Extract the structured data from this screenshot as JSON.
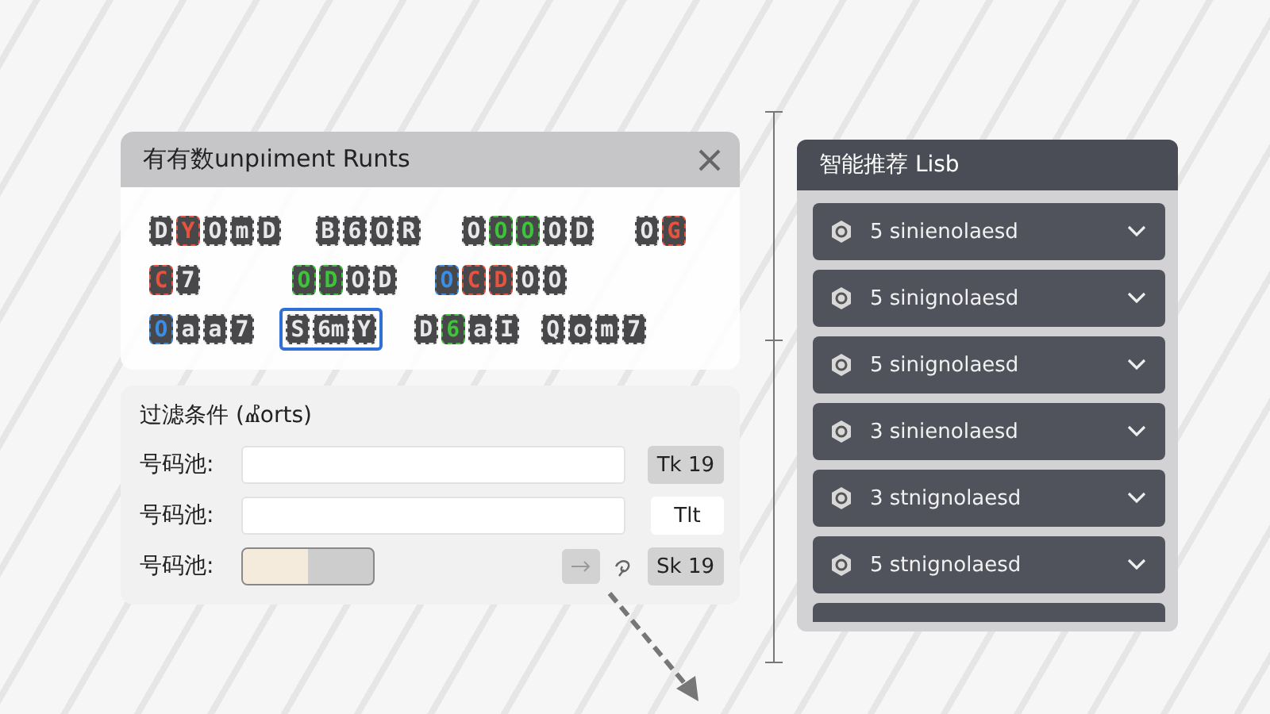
{
  "dialog": {
    "title": "有有数unpıiment Runts",
    "tile_rows": [
      [
        {
          "selected": false,
          "tiles": [
            {
              "char": "D",
              "color": "#e8e8e8"
            },
            {
              "char": "Y",
              "color": "#e8533f"
            },
            {
              "char": "O",
              "color": "#e8e8e8"
            },
            {
              "char": "m",
              "color": "#e8e8e8"
            },
            {
              "char": "D",
              "color": "#e8e8e8"
            }
          ]
        },
        {
          "selected": false,
          "tiles": [
            {
              "char": "B",
              "color": "#e8e8e8"
            },
            {
              "char": "6",
              "color": "#e8e8e8"
            },
            {
              "char": "O",
              "color": "#e8e8e8"
            },
            {
              "char": "R",
              "color": "#e8e8e8"
            }
          ]
        },
        {
          "selected": false,
          "tiles": [
            {
              "char": "O",
              "color": "#e8e8e8"
            },
            {
              "char": "O",
              "color": "#3ec43a"
            },
            {
              "char": "O",
              "color": "#3ec43a"
            },
            {
              "char": "O",
              "color": "#e8e8e8"
            },
            {
              "char": "D",
              "color": "#e8e8e8"
            }
          ]
        },
        {
          "selected": false,
          "tiles": [
            {
              "char": "O",
              "color": "#e8e8e8"
            },
            {
              "char": "G",
              "color": "#e8533f"
            }
          ]
        }
      ],
      [
        {
          "selected": false,
          "tiles": [
            {
              "char": "C",
              "color": "#e8533f"
            },
            {
              "char": "7",
              "color": "#e8e8e8"
            }
          ]
        },
        {
          "selected": false,
          "tiles": [
            {
              "char": "O",
              "color": "#3ec43a"
            },
            {
              "char": "D",
              "color": "#3ec43a"
            },
            {
              "char": "O",
              "color": "#e8e8e8"
            },
            {
              "char": "D",
              "color": "#e8e8e8"
            }
          ]
        },
        {
          "selected": false,
          "tiles": [
            {
              "char": "O",
              "color": "#3a8ee8"
            },
            {
              "char": "C",
              "color": "#e8533f"
            },
            {
              "char": "D",
              "color": "#e8533f"
            },
            {
              "char": "O",
              "color": "#e8e8e8"
            },
            {
              "char": "O",
              "color": "#e8e8e8"
            }
          ]
        }
      ],
      [
        {
          "selected": false,
          "tiles": [
            {
              "char": "O",
              "color": "#3a8ee8"
            },
            {
              "char": "a",
              "color": "#e8e8e8"
            },
            {
              "char": "a",
              "color": "#e8e8e8"
            },
            {
              "char": "7",
              "color": "#e8e8e8"
            }
          ]
        },
        {
          "selected": true,
          "tiles": [
            {
              "char": "S",
              "color": "#e8e8e8"
            },
            {
              "char": "6m",
              "color": "#e8e8e8"
            },
            {
              "char": "Y",
              "color": "#e8e8e8"
            }
          ]
        },
        {
          "selected": false,
          "tiles": [
            {
              "char": "D",
              "color": "#e8e8e8"
            },
            {
              "char": "6",
              "color": "#3ec43a"
            },
            {
              "char": "a",
              "color": "#e8e8e8"
            },
            {
              "char": "I",
              "color": "#e8e8e8"
            }
          ]
        },
        {
          "selected": false,
          "tiles": [
            {
              "char": "Q",
              "color": "#e8e8e8"
            },
            {
              "char": "o",
              "color": "#e8e8e8"
            },
            {
              "char": "m",
              "color": "#e8e8e8"
            },
            {
              "char": "7",
              "color": "#e8e8e8"
            }
          ]
        }
      ]
    ]
  },
  "filter": {
    "title": "过滤条件 (Ⰼorts)",
    "rows": [
      {
        "label": "号码池:",
        "kind": "input",
        "button": "Tk 19",
        "highlighted": true
      },
      {
        "label": "号码池:",
        "kind": "input",
        "button": "Tlt",
        "highlighted": false
      },
      {
        "label": "号码池:",
        "kind": "range",
        "level": 0.5,
        "button": "Sk 19",
        "highlighted": true
      }
    ]
  },
  "recommend": {
    "title": "智能推荐 Lisb",
    "items": [
      {
        "kind": "full",
        "label": "5 sinienolaesd"
      },
      {
        "kind": "full",
        "label": "5 sinignolaesd"
      },
      {
        "kind": "full",
        "label": "5 sinignolaesd"
      },
      {
        "kind": "full",
        "label": "3 sinienolaesd"
      },
      {
        "kind": "full",
        "label": "3 stnignolaesd"
      },
      {
        "kind": "full",
        "label": "5 stnignolaesd"
      },
      {
        "kind": "peek"
      }
    ]
  }
}
